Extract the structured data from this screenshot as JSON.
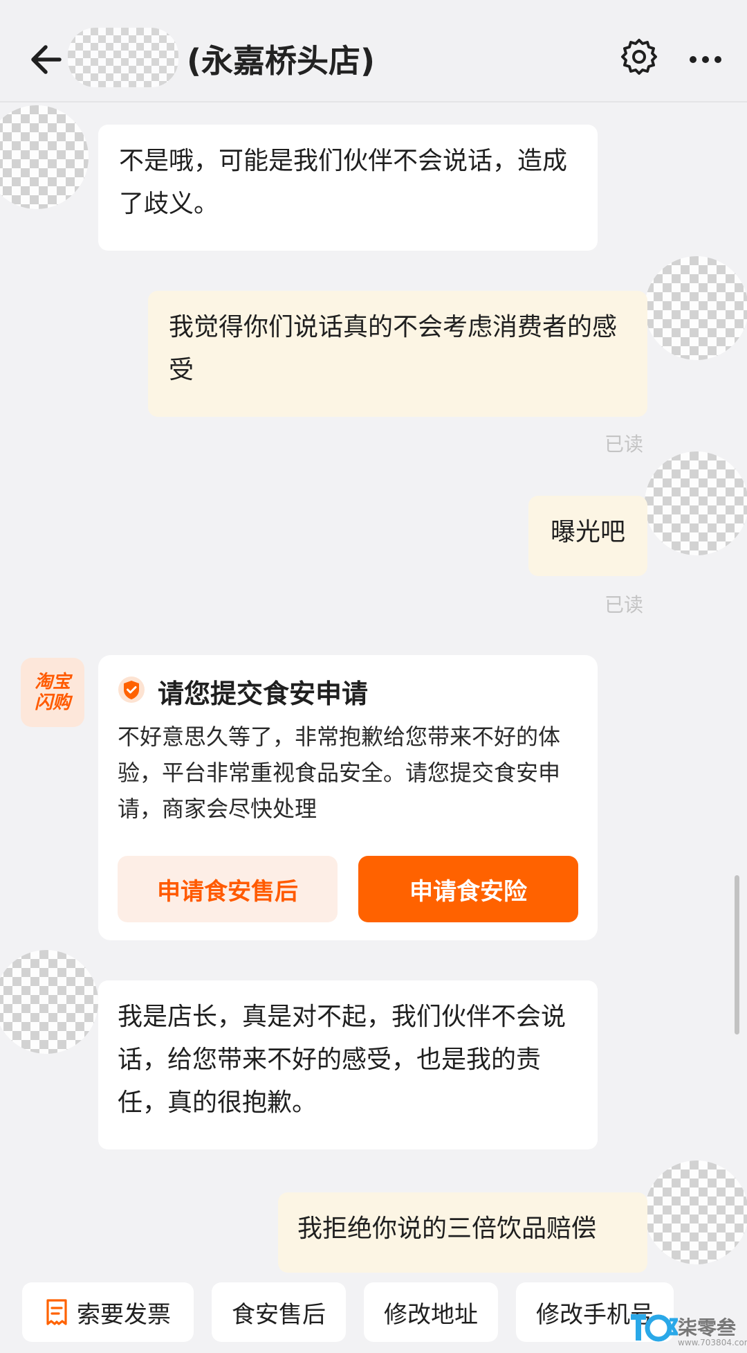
{
  "header": {
    "title": "(永嘉桥头店)"
  },
  "messages": {
    "m1": "不是哦，可能是我们伙伴不会说话，造成了歧义。",
    "m2": "我觉得你们说话真的不会考虑消费者的感受",
    "m2_status": "已读",
    "m3": "曝光吧",
    "m3_status": "已读",
    "m5": "我是店长，真是对不起，我们伙伴不会说话，给您带来不好的感受，也是我的责任，真的很抱歉。",
    "m6": "我拒绝你说的三倍饮品赔偿"
  },
  "platform_logo": {
    "line1": "淘宝",
    "line2": "闪购"
  },
  "card": {
    "title": "请您提交食安申请",
    "body": "不好意思久等了，非常抱歉给您带来不好的体验，平台非常重视食品安全。请您提交食安申请，商家会尽快处理",
    "btn_secondary": "申请食安售后",
    "btn_primary": "申请食安险"
  },
  "quick_actions": {
    "invoice": "索要发票",
    "after_sale": "食安售后",
    "edit_address": "修改地址",
    "edit_phone": "修改手机号"
  },
  "watermark": {
    "text": "柒零叁",
    "url": "www.703804.com"
  },
  "colors": {
    "accent": "#ff6200",
    "out_bubble": "#fcf5e4",
    "background": "#f2f2f4"
  }
}
